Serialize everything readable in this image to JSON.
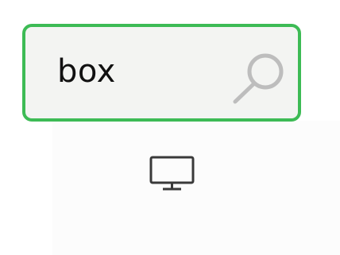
{
  "search": {
    "query": "box",
    "icons": {
      "search": "search-icon",
      "device": "monitor-icon"
    }
  },
  "colors": {
    "border": "#3dbb55",
    "field_background": "#f3f4f2",
    "icon_gray": "#bdbdbd",
    "monitor": "#3a3a3a"
  }
}
